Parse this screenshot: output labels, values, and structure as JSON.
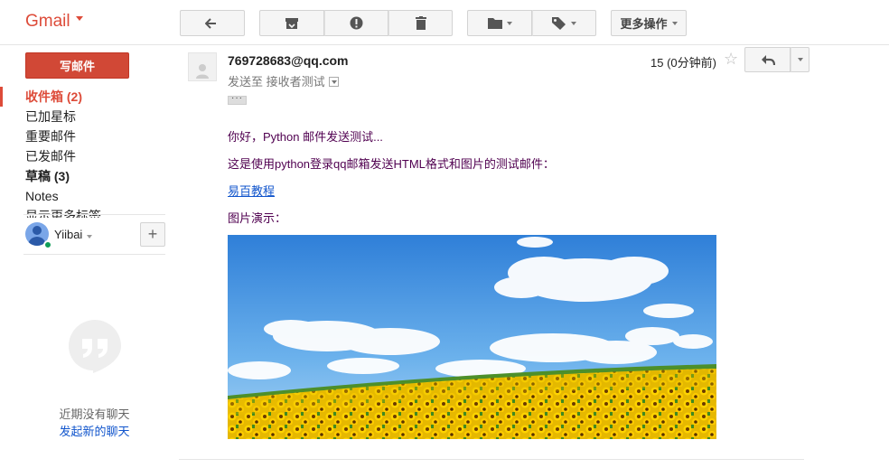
{
  "app": {
    "logo": "Gmail"
  },
  "toolbar": {
    "back_icon": "back-arrow-icon",
    "archive_icon": "archive-icon",
    "spam_icon": "report-spam-icon",
    "delete_icon": "trash-icon",
    "move_icon": "folder-icon",
    "label_icon": "label-tag-icon",
    "more_label": "更多操作"
  },
  "sidebar": {
    "compose_label": "写邮件",
    "items": [
      {
        "label": "收件箱 (2)",
        "state": "active"
      },
      {
        "label": "已加星标",
        "state": "normal"
      },
      {
        "label": "重要邮件",
        "state": "normal"
      },
      {
        "label": "已发邮件",
        "state": "normal"
      },
      {
        "label": "草稿 (3)",
        "state": "bold"
      },
      {
        "label": "Notes",
        "state": "normal"
      },
      {
        "label": "显示更多标签",
        "state": "normal"
      }
    ],
    "user_name": "Yiibai",
    "add_label": "+",
    "no_chats": "近期没有聊天",
    "start_chat": "发起新的聊天"
  },
  "message": {
    "from": "769728683@qq.com",
    "to_line": "发送至 接收者测试",
    "time": "15 (0分钟前)",
    "star": "☆",
    "ellipsis": "···",
    "body": {
      "greeting": "你好，Python 邮件发送测试...",
      "intro": "这是使用python登录qq邮箱发送HTML格式和图片的测试邮件：",
      "link": "易百教程",
      "image_caption": "图片演示："
    }
  },
  "colors": {
    "brand_red": "#dd4b39",
    "compose_red": "#d14836",
    "link_blue": "#1155cc",
    "body_purple": "#500050",
    "online_green": "#0f9d58"
  }
}
